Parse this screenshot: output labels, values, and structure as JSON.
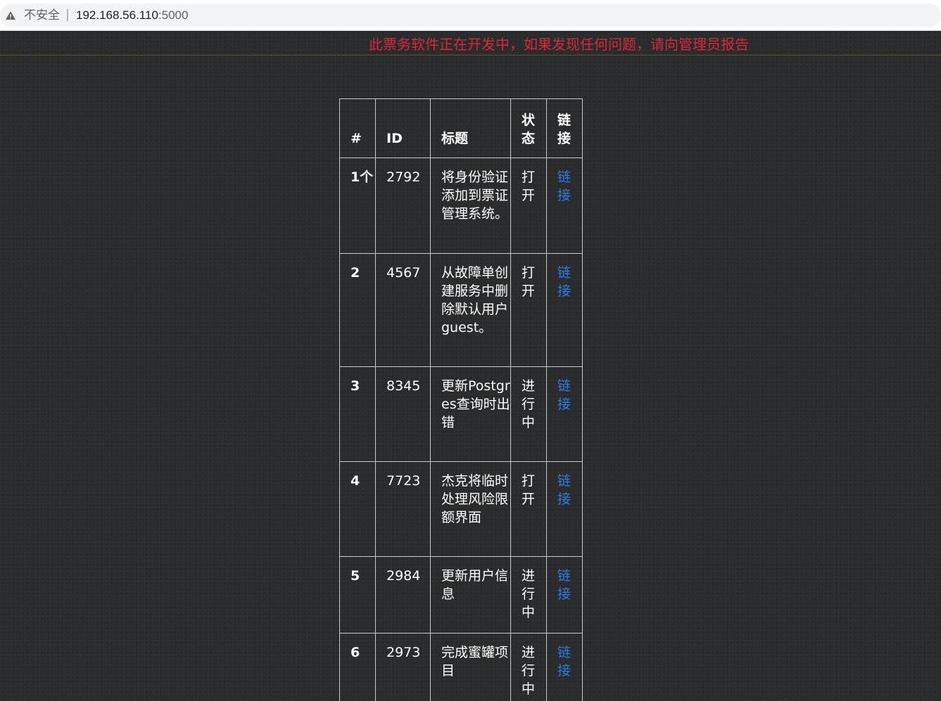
{
  "browser": {
    "security_label": "不安全",
    "separator": "|",
    "url_host": "192.168.56.110",
    "url_port": ":5000"
  },
  "banner": {
    "text": "此票务软件正在开发中，如果发现任何问题，请向管理员报告",
    "color": "#d8283a"
  },
  "table": {
    "headers": [
      "#",
      "ID",
      "标题",
      "状态",
      "链接"
    ],
    "rows": [
      {
        "num": "1个",
        "id": "2792",
        "title": "将身份验证添加到票证管理系统。",
        "status": "打开",
        "link": "链接"
      },
      {
        "num": "2",
        "id": "4567",
        "title": "从故障单创建服务中删除默认用户guest。",
        "status": "打开",
        "link": "链接"
      },
      {
        "num": "3",
        "id": "8345",
        "title": "更新Postgres查询时出错",
        "status": "进行中",
        "link": "链接"
      },
      {
        "num": "4",
        "id": "7723",
        "title": "杰克将临时处理风险限额界面",
        "status": "打开",
        "link": "链接"
      },
      {
        "num": "5",
        "id": "2984",
        "title": "更新用户信息",
        "status": "进行中",
        "link": "链接"
      },
      {
        "num": "6",
        "id": "2973",
        "title": "完成蜜罐项目",
        "status": "进行中",
        "link": "链接"
      }
    ]
  },
  "colors": {
    "background": "#2a2b2c",
    "link": "#2b7be3",
    "text": "#ffffff"
  }
}
